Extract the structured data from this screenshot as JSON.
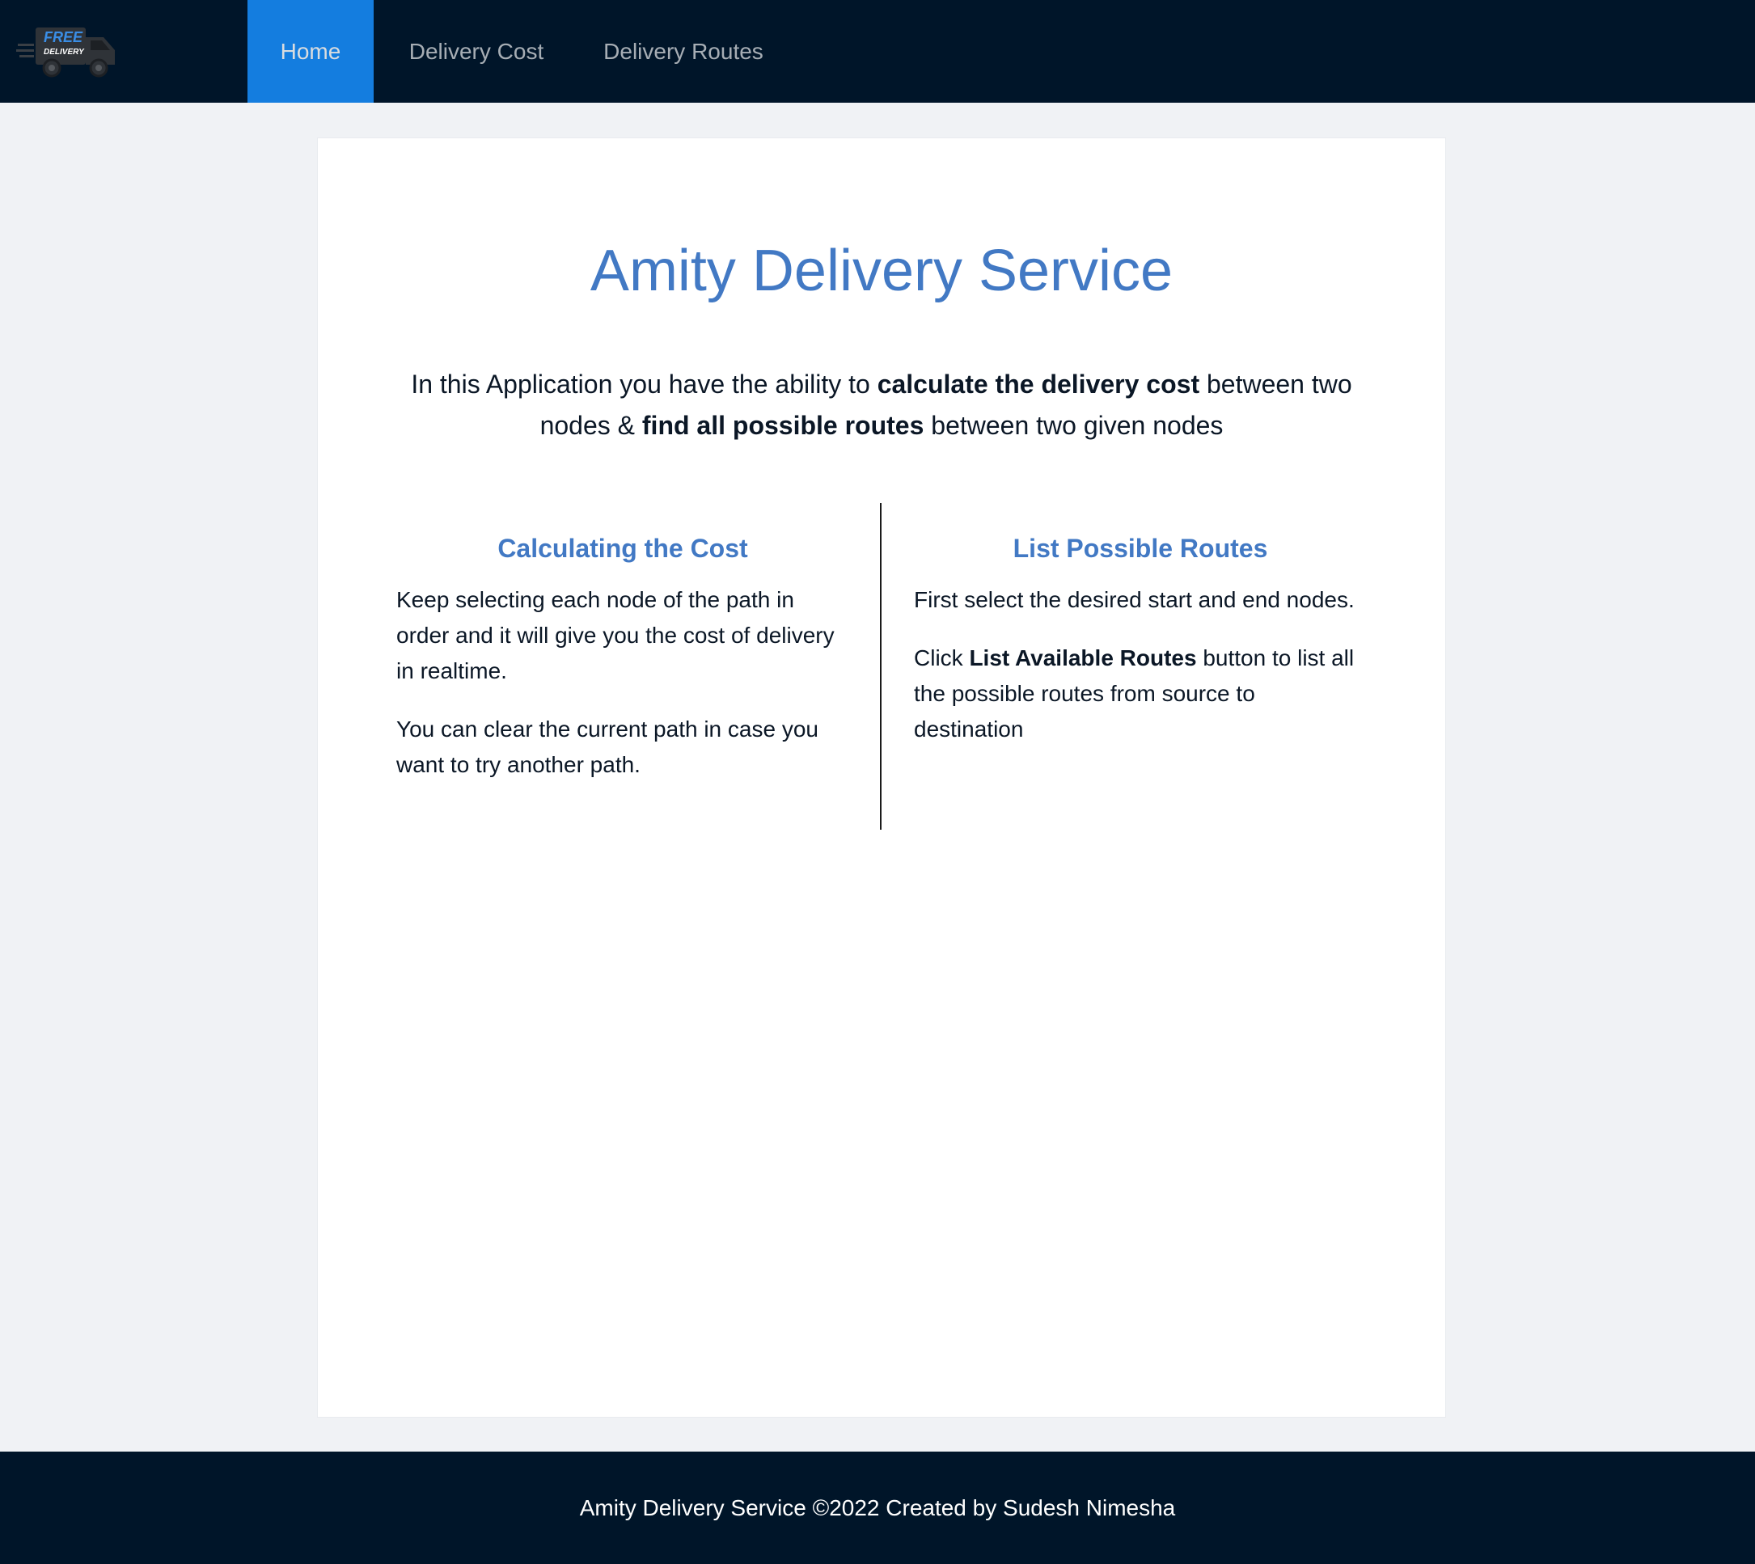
{
  "header": {
    "logo": {
      "text_top": "FREE",
      "text_bottom": "DELIVERY"
    },
    "nav": [
      {
        "label": "Home",
        "active": true
      },
      {
        "label": "Delivery Cost",
        "active": false
      },
      {
        "label": "Delivery Routes",
        "active": false
      }
    ]
  },
  "main": {
    "title": "Amity Delivery Service",
    "intro": {
      "t1": "In this Application you have the ability to ",
      "b1": "calculate the delivery cost",
      "t2": " between two nodes & ",
      "b2": "find all possible routes",
      "t3": " between two given nodes"
    },
    "left": {
      "heading": "Calculating the Cost",
      "p1": "Keep selecting each node of the path in order and it will give you the cost of delivery in realtime.",
      "p2": "You can clear the current path in case you want to try another path."
    },
    "right": {
      "heading": "List Possible Routes",
      "p1": "First select the desired start and end nodes.",
      "p2_pre": "Click ",
      "p2_bold": "List Available Routes",
      "p2_post": " button to list all the possible routes from source to destination"
    }
  },
  "footer": {
    "text": "Amity Delivery Service ©2022 Created by Sudesh Nimesha"
  },
  "colors": {
    "header_bg": "#001529",
    "active_nav": "#1890ff",
    "accent": "#4279c4",
    "page_bg": "#f0f2f5"
  }
}
